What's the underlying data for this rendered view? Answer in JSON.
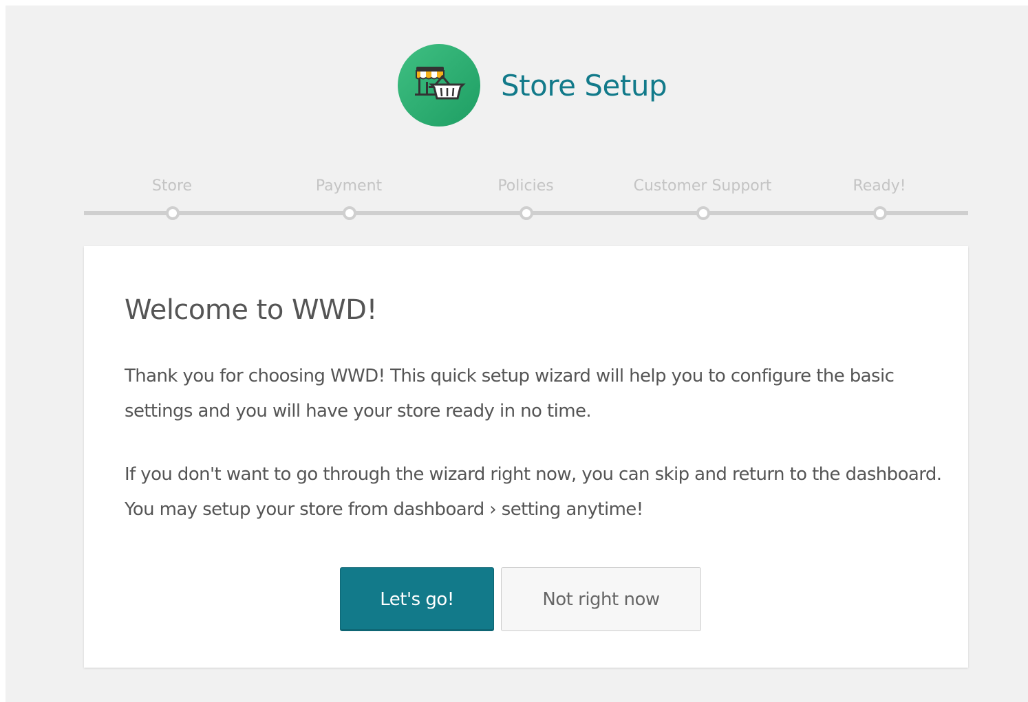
{
  "header": {
    "logo_icon": "storefront-basket-icon",
    "title": "Store Setup"
  },
  "steps": [
    {
      "label": "Store"
    },
    {
      "label": "Payment"
    },
    {
      "label": "Policies"
    },
    {
      "label": "Customer Support"
    },
    {
      "label": "Ready!"
    }
  ],
  "card": {
    "heading": "Welcome to WWD!",
    "paragraph1": "Thank you for choosing WWD! This quick setup wizard will help you to configure the basic settings and you will have your store ready in no time.",
    "paragraph2": "If you don't want to go through the wizard right now, you can skip and return to the dashboard. You may setup your store from dashboard › setting anytime!",
    "primary_button": "Let's go!",
    "secondary_button": "Not right now"
  },
  "colors": {
    "accent": "#127a8a",
    "logo_green": "#2bb373",
    "background": "#f1f1f1"
  }
}
